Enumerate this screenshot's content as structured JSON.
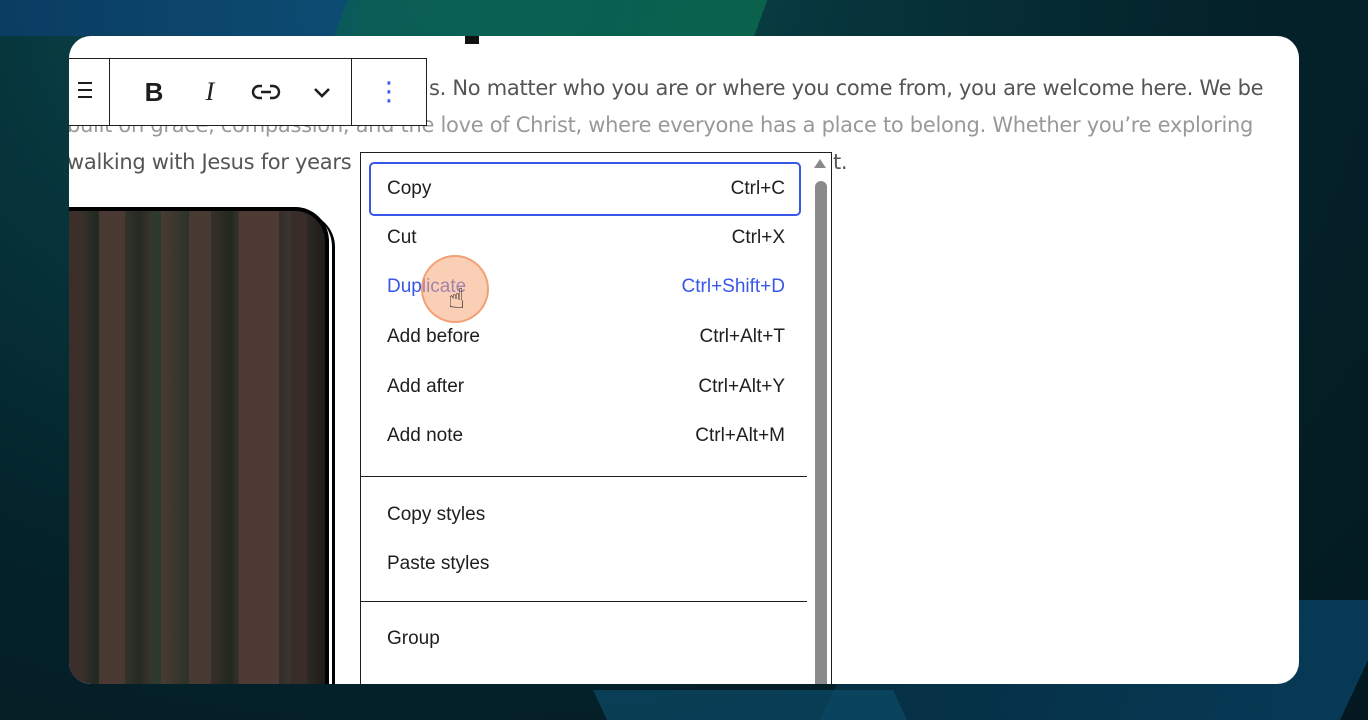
{
  "paragraph": {
    "line1": "s. No matter who you are or where you come from, you are welcome here. We be",
    "line2": "built on grace, compassion, and the love of Christ, where everyone has a place to belong. Whether you’re exploring",
    "line3": "walking with Jesus for years",
    "line3_tail": "t."
  },
  "toolbar": {
    "bold_label": "B",
    "italic_label": "I",
    "more_glyph": "⋮",
    "chevron_glyph": "⌄"
  },
  "menu": {
    "items": [
      {
        "label": "Copy",
        "shortcut": "Ctrl+C"
      },
      {
        "label": "Cut",
        "shortcut": "Ctrl+X"
      },
      {
        "label": "Duplicate",
        "shortcut": "Ctrl+Shift+D"
      },
      {
        "label": "Add before",
        "shortcut": "Ctrl+Alt+T"
      },
      {
        "label": "Add after",
        "shortcut": "Ctrl+Alt+Y"
      },
      {
        "label": "Add note",
        "shortcut": "Ctrl+Alt+M"
      },
      {
        "label": "Copy styles",
        "shortcut": ""
      },
      {
        "label": "Paste styles",
        "shortcut": ""
      },
      {
        "label": "Group",
        "shortcut": ""
      }
    ]
  },
  "colors": {
    "accent": "#3858e9",
    "cursor": "#f7a878"
  }
}
